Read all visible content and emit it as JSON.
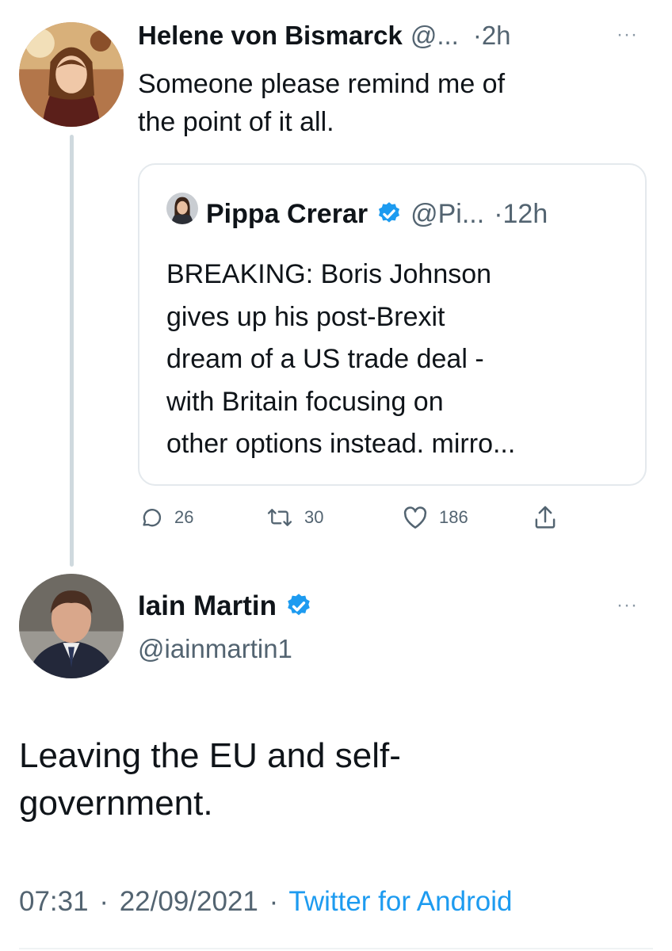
{
  "thread": {
    "reply": {
      "author_name": "Helene von Bismarck",
      "handle": "@...",
      "time": "·2h",
      "more_icon": "···",
      "text_line1": "Someone please remind me of",
      "text_line2": "the point of it all.",
      "quote": {
        "author_name": "Pippa Crerar",
        "handle": "@Pi...",
        "time": "·12h",
        "lines": [
          "BREAKING: Boris Johnson",
          "gives up his post-Brexit",
          "dream of a US trade deal -",
          "with  Britain focusing on",
          "other options instead. mirro..."
        ]
      },
      "actions": {
        "replies": "26",
        "retweets": "30",
        "likes": "186"
      }
    },
    "main": {
      "author_name": "Iain Martin",
      "handle": "@iainmartin1",
      "more_icon": "···",
      "text_line1": "Leaving the EU and self-",
      "text_line2": "government.",
      "time": "07:31",
      "date": "22/09/2021",
      "sep": "·",
      "source": "Twitter for Android"
    }
  },
  "colors": {
    "accent": "#1d9bf0",
    "muted": "#536471",
    "border": "#e4e9ed",
    "thread_line": "#cfd9de"
  },
  "icons": [
    "reply-icon",
    "retweet-icon",
    "like-icon",
    "share-icon",
    "verified-icon",
    "more-icon"
  ]
}
